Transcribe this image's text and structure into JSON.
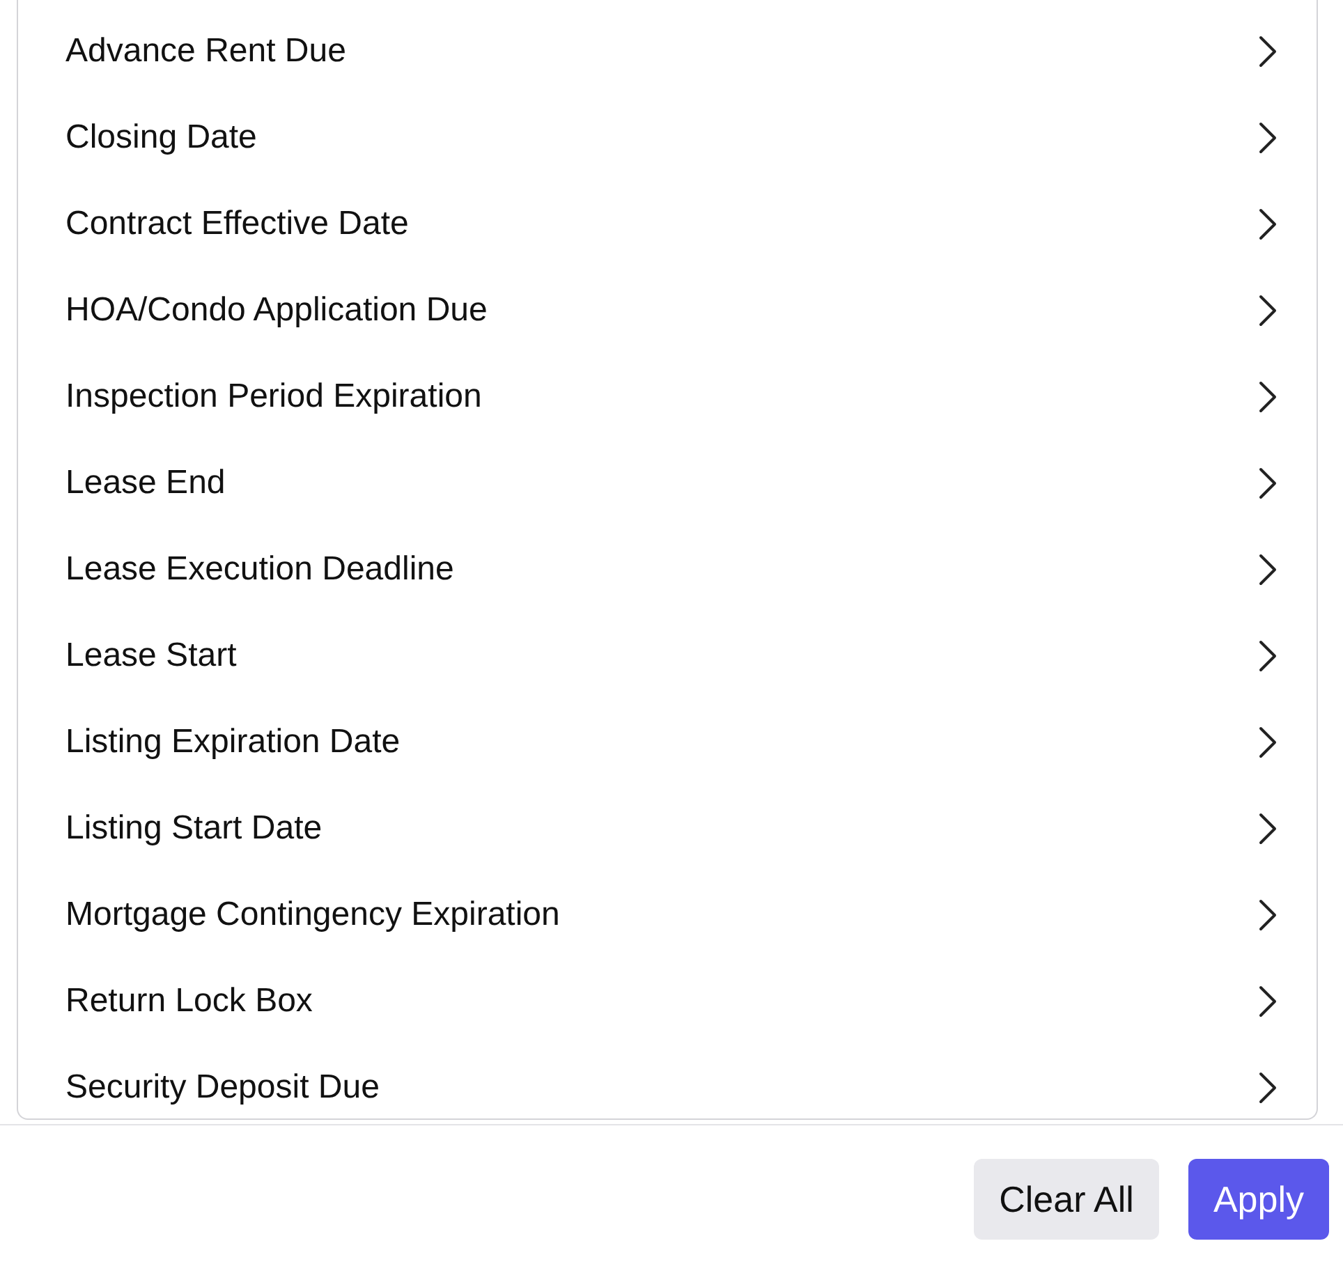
{
  "items": [
    {
      "label": "Advance Rent Due"
    },
    {
      "label": "Closing Date"
    },
    {
      "label": "Contract Effective Date"
    },
    {
      "label": "HOA/Condo Application Due"
    },
    {
      "label": "Inspection Period Expiration"
    },
    {
      "label": "Lease End"
    },
    {
      "label": "Lease Execution Deadline"
    },
    {
      "label": "Lease Start"
    },
    {
      "label": "Listing Expiration Date"
    },
    {
      "label": "Listing Start Date"
    },
    {
      "label": "Mortgage Contingency Expiration"
    },
    {
      "label": "Return Lock Box"
    },
    {
      "label": "Security Deposit Due"
    }
  ],
  "buttons": [
    {
      "label": "Clear All",
      "kind": "secondary"
    },
    {
      "label": "Apply",
      "kind": "primary"
    }
  ]
}
